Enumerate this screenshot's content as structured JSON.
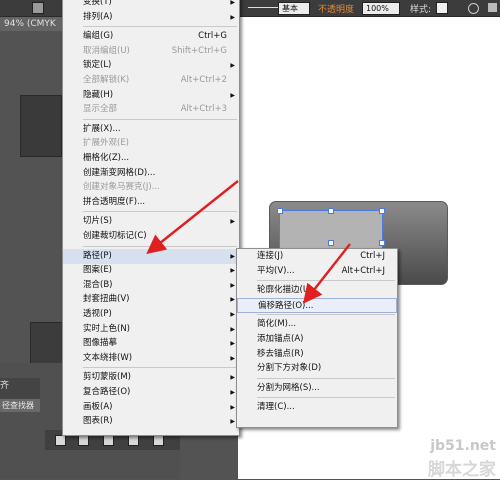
{
  "toolbar": {
    "stroke_label": "基本",
    "opacity_label": "不透明度",
    "opacity_value": "100%",
    "style_label": "样式:"
  },
  "document": {
    "tab_label": "94% (CMYK"
  },
  "panels": {
    "pathfinder_tab": "径查找器",
    "panel_head": "齐"
  },
  "object_menu": {
    "items": [
      {
        "label": "变换(T)",
        "shortcut": "",
        "arrow": true,
        "disabled": false
      },
      {
        "label": "排列(A)",
        "shortcut": "",
        "arrow": true,
        "disabled": false
      },
      {
        "sep": true
      },
      {
        "label": "编组(G)",
        "shortcut": "Ctrl+G",
        "arrow": false,
        "disabled": false
      },
      {
        "label": "取消编组(U)",
        "shortcut": "Shift+Ctrl+G",
        "arrow": false,
        "disabled": true
      },
      {
        "label": "锁定(L)",
        "shortcut": "",
        "arrow": true,
        "disabled": false
      },
      {
        "label": "全部解锁(K)",
        "shortcut": "Alt+Ctrl+2",
        "arrow": false,
        "disabled": true
      },
      {
        "label": "隐藏(H)",
        "shortcut": "",
        "arrow": true,
        "disabled": false
      },
      {
        "label": "显示全部",
        "shortcut": "Alt+Ctrl+3",
        "arrow": false,
        "disabled": true
      },
      {
        "sep": true
      },
      {
        "label": "扩展(X)...",
        "shortcut": "",
        "arrow": false,
        "disabled": false
      },
      {
        "label": "扩展外观(E)",
        "shortcut": "",
        "arrow": false,
        "disabled": true
      },
      {
        "label": "栅格化(Z)...",
        "shortcut": "",
        "arrow": false,
        "disabled": false
      },
      {
        "label": "创建渐变网格(D)...",
        "shortcut": "",
        "arrow": false,
        "disabled": false
      },
      {
        "label": "创建对象马赛克(J)...",
        "shortcut": "",
        "arrow": false,
        "disabled": true
      },
      {
        "label": "拼合透明度(F)...",
        "shortcut": "",
        "arrow": false,
        "disabled": false
      },
      {
        "sep": true
      },
      {
        "label": "切片(S)",
        "shortcut": "",
        "arrow": true,
        "disabled": false
      },
      {
        "label": "创建裁切标记(C)",
        "shortcut": "",
        "arrow": false,
        "disabled": false
      },
      {
        "sep": true
      },
      {
        "label": "路径(P)",
        "shortcut": "",
        "arrow": true,
        "disabled": false,
        "highlighted": true
      },
      {
        "label": "图案(E)",
        "shortcut": "",
        "arrow": true,
        "disabled": false
      },
      {
        "label": "混合(B)",
        "shortcut": "",
        "arrow": true,
        "disabled": false
      },
      {
        "label": "封套扭曲(V)",
        "shortcut": "",
        "arrow": true,
        "disabled": false
      },
      {
        "label": "透视(P)",
        "shortcut": "",
        "arrow": true,
        "disabled": false
      },
      {
        "label": "实时上色(N)",
        "shortcut": "",
        "arrow": true,
        "disabled": false
      },
      {
        "label": "图像描摹",
        "shortcut": "",
        "arrow": true,
        "disabled": false
      },
      {
        "label": "文本绕排(W)",
        "shortcut": "",
        "arrow": true,
        "disabled": false
      },
      {
        "sep": true
      },
      {
        "label": "剪切蒙版(M)",
        "shortcut": "",
        "arrow": true,
        "disabled": false
      },
      {
        "label": "复合路径(O)",
        "shortcut": "",
        "arrow": true,
        "disabled": false
      },
      {
        "label": "画板(A)",
        "shortcut": "",
        "arrow": true,
        "disabled": false
      },
      {
        "label": "图表(R)",
        "shortcut": "",
        "arrow": true,
        "disabled": false
      }
    ]
  },
  "path_submenu": {
    "items": [
      {
        "label": "连接(J)",
        "shortcut": "Ctrl+J"
      },
      {
        "label": "平均(V)...",
        "shortcut": "Alt+Ctrl+J"
      },
      {
        "sep": true
      },
      {
        "label": "轮廓化描边(U)",
        "shortcut": ""
      },
      {
        "label": "偏移路径(O)...",
        "shortcut": "",
        "boxed": true
      },
      {
        "sep": true
      },
      {
        "label": "简化(M)...",
        "shortcut": ""
      },
      {
        "label": "添加锚点(A)",
        "shortcut": ""
      },
      {
        "label": "移去锚点(R)",
        "shortcut": ""
      },
      {
        "label": "分割下方对象(D)",
        "shortcut": ""
      },
      {
        "sep": true
      },
      {
        "label": "分割为网格(S)...",
        "shortcut": ""
      },
      {
        "sep": true
      },
      {
        "label": "清理(C)...",
        "shortcut": ""
      }
    ]
  },
  "watermark": {
    "line1": "jb51.net",
    "line2": "脚本之家"
  },
  "colors": {
    "arrow": "#e02020",
    "selection": "#4f7bd9",
    "highlight": "#d6e0ef"
  }
}
